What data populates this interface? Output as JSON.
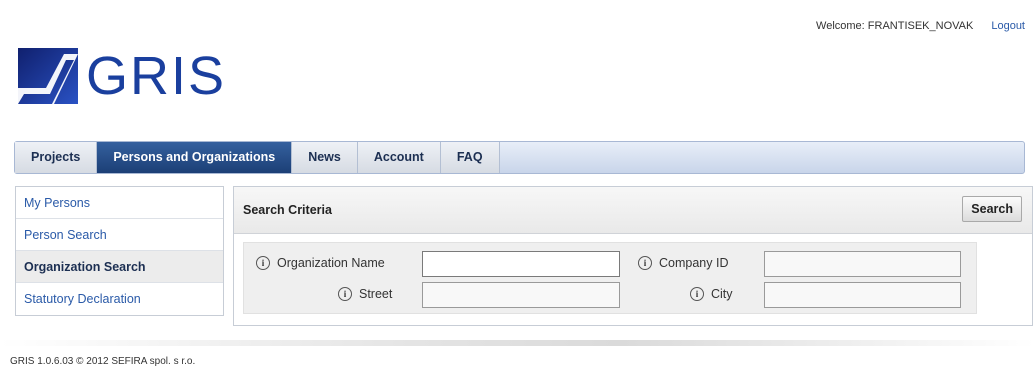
{
  "header": {
    "welcome": "Welcome: FRANTISEK_NOVAK",
    "logout": "Logout",
    "logo_text": "GRIS"
  },
  "nav": {
    "items": [
      {
        "label": "Projects"
      },
      {
        "label": "Persons and Organizations",
        "active": true
      },
      {
        "label": "News"
      },
      {
        "label": "Account"
      },
      {
        "label": "FAQ"
      }
    ]
  },
  "sidebar": {
    "items": [
      {
        "label": "My Persons"
      },
      {
        "label": "Person Search"
      },
      {
        "label": "Organization Search",
        "active": true
      },
      {
        "label": "Statutory Declaration"
      }
    ]
  },
  "search": {
    "title": "Search Criteria",
    "button": "Search",
    "fields": {
      "organization_name": {
        "label": "Organization Name",
        "value": ""
      },
      "company_id": {
        "label": "Company ID",
        "value": ""
      },
      "street": {
        "label": "Street",
        "value": ""
      },
      "city": {
        "label": "City",
        "value": ""
      }
    },
    "info_icon": "info-icon"
  },
  "footer": {
    "text": "GRIS 1.0.6.03 © 2012 SEFIRA spol. s r.o."
  },
  "colors": {
    "brand": "#1a3f9e",
    "nav_active": "#1c3f76",
    "link": "#2a5aa8"
  }
}
